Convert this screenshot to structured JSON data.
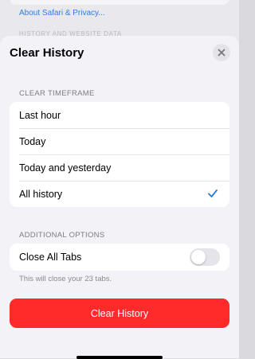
{
  "background": {
    "link_text": "About Safari & Privacy...",
    "faded_header": "HISTORY AND WEBSITE DATA"
  },
  "sheet": {
    "title": "Clear History",
    "close_icon": "close-icon"
  },
  "timeframe": {
    "section_label": "CLEAR TIMEFRAME",
    "options": [
      {
        "label": "Last hour",
        "selected": false
      },
      {
        "label": "Today",
        "selected": false
      },
      {
        "label": "Today and yesterday",
        "selected": false
      },
      {
        "label": "All history",
        "selected": true
      }
    ],
    "check_color": "#2f7de0"
  },
  "additional": {
    "section_label": "ADDITIONAL OPTIONS",
    "close_tabs_label": "Close All Tabs",
    "close_tabs_enabled": false,
    "footnote": "This will close your 23 tabs."
  },
  "action": {
    "button_label": "Clear History",
    "button_color": "#ff2a2a"
  }
}
